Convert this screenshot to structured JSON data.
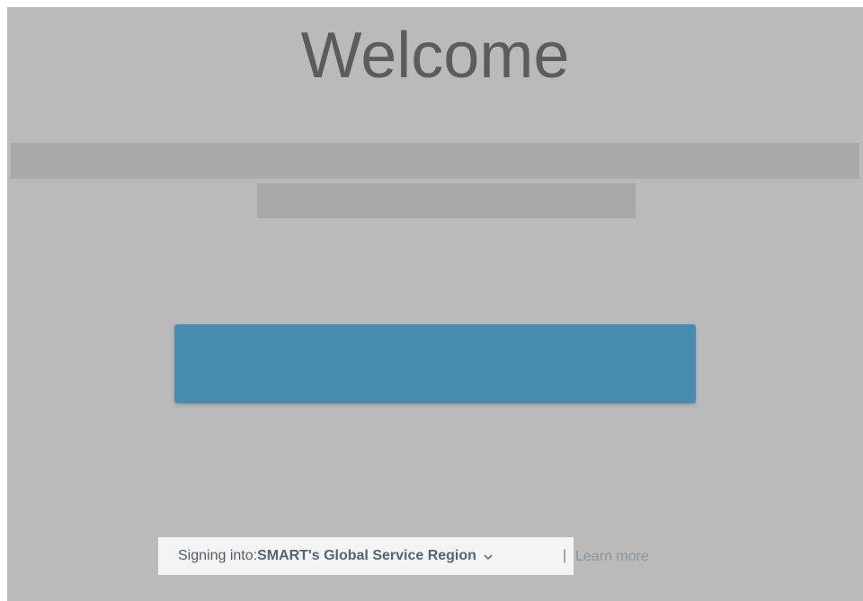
{
  "page": {
    "title": "Welcome"
  },
  "footer": {
    "signing_label": "Signing into:",
    "region_name": "SMART's Global Service Region",
    "separator": "|",
    "learn_more": "Learn more"
  },
  "icons": {
    "region_dropdown": "chevron-down-icon"
  },
  "colors": {
    "background": "#bababa",
    "primary_button": "#478cae",
    "title_text": "#5c5c5c"
  }
}
